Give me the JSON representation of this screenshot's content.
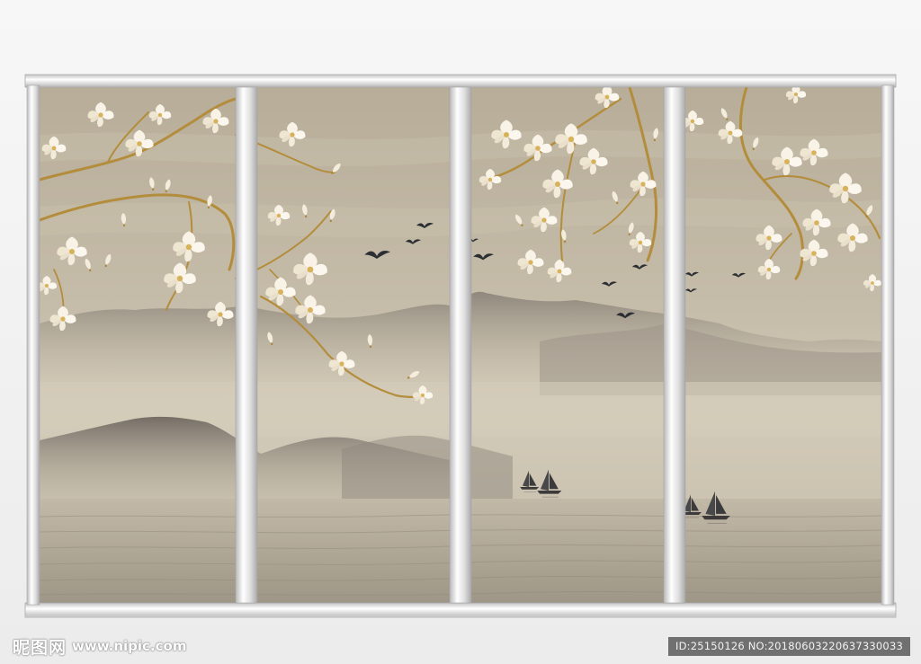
{
  "artwork": {
    "panel_count": 4,
    "bird_count": 11,
    "sailboat_count": 4,
    "colors": {
      "sky": "#bdb39f",
      "mist": "#d2cab8",
      "far_mountains": "#9e968a",
      "near_mountains": "#7f786f",
      "water": "#aca393",
      "frame": "#d6d6d6",
      "blossom": "#f7f1e2",
      "branch": "#b6903c",
      "bird": "#2b2e33"
    }
  },
  "watermark": {
    "logo": "昵图网",
    "url": "www.nipic.com",
    "id_label": "ID:25150126 NO:20180603220637330033"
  }
}
